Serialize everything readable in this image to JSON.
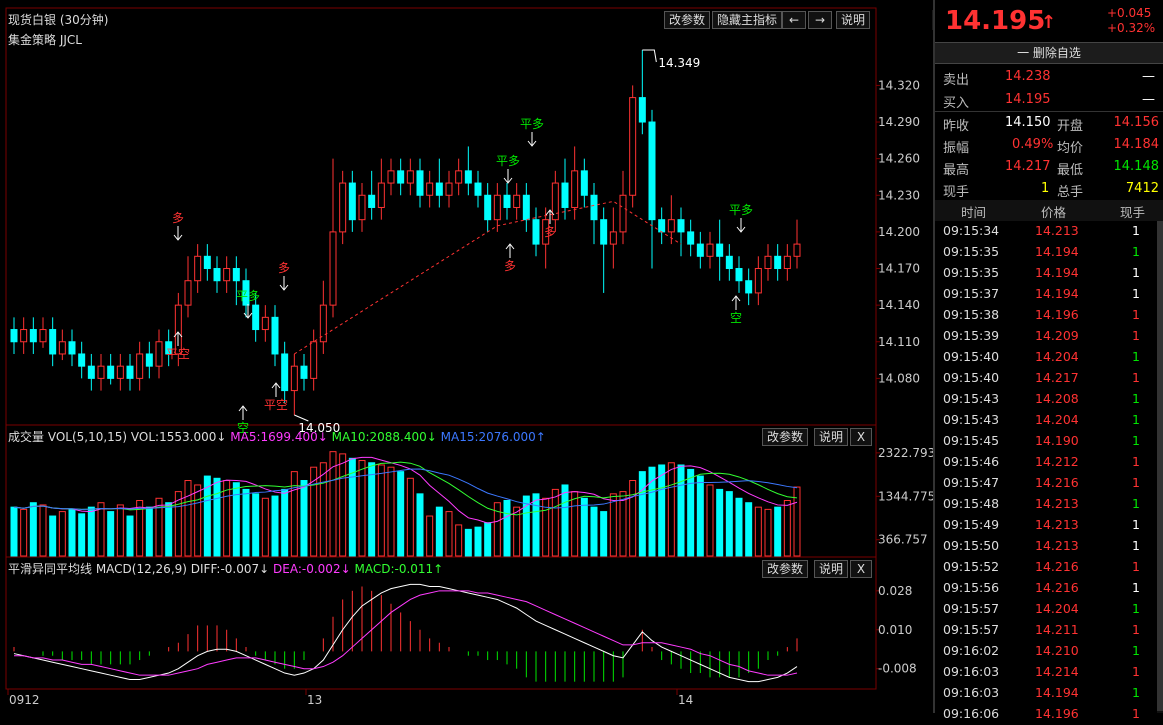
{
  "main_panel": {
    "title": "现货白银 (30分钟)",
    "subtitle": "集金策略 JJCL",
    "buttons": [
      "改参数",
      "隐藏主指标",
      "←",
      "→",
      "说明"
    ],
    "y_ticks": [
      "14.320",
      "14.290",
      "14.260",
      "14.230",
      "14.200",
      "14.170",
      "14.140",
      "14.110",
      "14.080"
    ],
    "high_label": "14.349",
    "low_label": "14.050",
    "signals": [
      "多",
      "平空",
      "平多",
      "空",
      "平空",
      "多",
      "平多",
      "平多",
      "多",
      "多",
      "平多",
      "空"
    ]
  },
  "volume_panel": {
    "title": "成交量 VOL(5,10,15) VOL:1553.000↓",
    "ma5": "MA5:1699.400↓",
    "ma10": "MA10:2088.400↓",
    "ma15": "MA15:2076.000↑",
    "buttons": [
      "改参数",
      "说明",
      "X"
    ],
    "y_ticks": [
      "2322.793",
      "1344.775",
      "366.757"
    ]
  },
  "macd_panel": {
    "title": "平滑异同平均线 MACD(12,26,9) DIFF:-0.007↓",
    "dea": "DEA:-0.002↓",
    "macd": "MACD:-0.011↑",
    "buttons": [
      "改参数",
      "说明",
      "X"
    ],
    "y_ticks": [
      "0.028",
      "0.010",
      "-0.008"
    ]
  },
  "x_axis": {
    "labels": [
      "0912",
      "13",
      "14"
    ]
  },
  "quote": {
    "name": "现货白银",
    "price": "14.195",
    "arrow": "↑",
    "change": "+0.045",
    "change_pct": "+0.32%",
    "remove_button": "一 删除自选",
    "sell_label": "卖出",
    "sell_price": "14.238",
    "sell_vol": "—",
    "buy_label": "买入",
    "buy_price": "14.195",
    "buy_vol": "—",
    "stats": [
      {
        "l1": "昨收",
        "v1": "14.150",
        "l2": "开盘",
        "v2": "14.156"
      },
      {
        "l1": "振幅",
        "v1": "0.49%",
        "l2": "均价",
        "v2": "14.184"
      },
      {
        "l1": "最高",
        "v1": "14.217",
        "l2": "最低",
        "v2": "14.148"
      },
      {
        "l1": "现手",
        "v1": "1",
        "l2": "总手",
        "v2": "7412"
      }
    ]
  },
  "ticks": {
    "headers": [
      "时间",
      "价格",
      "现手"
    ],
    "rows": [
      {
        "time": "09:15:34",
        "price": "14.213",
        "vol": "1",
        "vc": "white"
      },
      {
        "time": "09:15:35",
        "price": "14.194",
        "vol": "1",
        "vc": "green"
      },
      {
        "time": "09:15:35",
        "price": "14.194",
        "vol": "1",
        "vc": "white"
      },
      {
        "time": "09:15:37",
        "price": "14.194",
        "vol": "1",
        "vc": "white"
      },
      {
        "time": "09:15:38",
        "price": "14.196",
        "vol": "1",
        "vc": "red"
      },
      {
        "time": "09:15:39",
        "price": "14.209",
        "vol": "1",
        "vc": "red"
      },
      {
        "time": "09:15:40",
        "price": "14.204",
        "vol": "1",
        "vc": "green"
      },
      {
        "time": "09:15:40",
        "price": "14.217",
        "vol": "1",
        "vc": "red"
      },
      {
        "time": "09:15:43",
        "price": "14.208",
        "vol": "1",
        "vc": "green"
      },
      {
        "time": "09:15:43",
        "price": "14.204",
        "vol": "1",
        "vc": "green"
      },
      {
        "time": "09:15:45",
        "price": "14.190",
        "vol": "1",
        "vc": "green"
      },
      {
        "time": "09:15:46",
        "price": "14.212",
        "vol": "1",
        "vc": "red"
      },
      {
        "time": "09:15:47",
        "price": "14.216",
        "vol": "1",
        "vc": "red"
      },
      {
        "time": "09:15:48",
        "price": "14.213",
        "vol": "1",
        "vc": "green"
      },
      {
        "time": "09:15:49",
        "price": "14.213",
        "vol": "1",
        "vc": "white"
      },
      {
        "time": "09:15:50",
        "price": "14.213",
        "vol": "1",
        "vc": "white"
      },
      {
        "time": "09:15:52",
        "price": "14.216",
        "vol": "1",
        "vc": "red"
      },
      {
        "time": "09:15:56",
        "price": "14.216",
        "vol": "1",
        "vc": "white"
      },
      {
        "time": "09:15:57",
        "price": "14.204",
        "vol": "1",
        "vc": "green"
      },
      {
        "time": "09:15:57",
        "price": "14.211",
        "vol": "1",
        "vc": "red"
      },
      {
        "time": "09:16:02",
        "price": "14.210",
        "vol": "1",
        "vc": "green"
      },
      {
        "time": "09:16:03",
        "price": "14.214",
        "vol": "1",
        "vc": "red"
      },
      {
        "time": "09:16:03",
        "price": "14.194",
        "vol": "1",
        "vc": "green"
      },
      {
        "time": "09:16:06",
        "price": "14.196",
        "vol": "1",
        "vc": "red"
      }
    ]
  },
  "chart_data": {
    "type": "candlestick",
    "price_range": [
      14.05,
      14.349
    ],
    "candles": [
      [
        14.12,
        14.11,
        14.13,
        14.1
      ],
      [
        14.11,
        14.12,
        14.13,
        14.1
      ],
      [
        14.12,
        14.11,
        14.13,
        14.1
      ],
      [
        14.11,
        14.12,
        14.13,
        14.105
      ],
      [
        14.12,
        14.1,
        14.13,
        14.09
      ],
      [
        14.1,
        14.11,
        14.12,
        14.095
      ],
      [
        14.11,
        14.1,
        14.12,
        14.09
      ],
      [
        14.1,
        14.09,
        14.11,
        14.08
      ],
      [
        14.09,
        14.08,
        14.1,
        14.07
      ],
      [
        14.08,
        14.09,
        14.1,
        14.07
      ],
      [
        14.09,
        14.08,
        14.1,
        14.075
      ],
      [
        14.08,
        14.09,
        14.1,
        14.07
      ],
      [
        14.09,
        14.08,
        14.1,
        14.07
      ],
      [
        14.08,
        14.1,
        14.11,
        14.07
      ],
      [
        14.1,
        14.09,
        14.11,
        14.08
      ],
      [
        14.09,
        14.11,
        14.12,
        14.08
      ],
      [
        14.11,
        14.1,
        14.12,
        14.09
      ],
      [
        14.1,
        14.14,
        14.15,
        14.09
      ],
      [
        14.14,
        14.16,
        14.18,
        14.13
      ],
      [
        14.16,
        14.18,
        14.19,
        14.15
      ],
      [
        14.18,
        14.17,
        14.19,
        14.16
      ],
      [
        14.17,
        14.16,
        14.18,
        14.15
      ],
      [
        14.16,
        14.17,
        14.18,
        14.15
      ],
      [
        14.17,
        14.16,
        14.18,
        14.14
      ],
      [
        14.16,
        14.14,
        14.17,
        14.13
      ],
      [
        14.14,
        14.12,
        14.15,
        14.11
      ],
      [
        14.12,
        14.13,
        14.14,
        14.11
      ],
      [
        14.13,
        14.1,
        14.14,
        14.09
      ],
      [
        14.1,
        14.07,
        14.11,
        14.06
      ],
      [
        14.07,
        14.09,
        14.1,
        14.05
      ],
      [
        14.09,
        14.08,
        14.1,
        14.07
      ],
      [
        14.08,
        14.11,
        14.12,
        14.07
      ],
      [
        14.11,
        14.14,
        14.16,
        14.1
      ],
      [
        14.14,
        14.2,
        14.26,
        14.13
      ],
      [
        14.2,
        14.24,
        14.25,
        14.19
      ],
      [
        14.24,
        14.21,
        14.25,
        14.2
      ],
      [
        14.21,
        14.23,
        14.24,
        14.2
      ],
      [
        14.23,
        14.22,
        14.25,
        14.21
      ],
      [
        14.22,
        14.24,
        14.26,
        14.21
      ],
      [
        14.24,
        14.25,
        14.26,
        14.23
      ],
      [
        14.25,
        14.24,
        14.26,
        14.23
      ],
      [
        14.24,
        14.25,
        14.26,
        14.23
      ],
      [
        14.25,
        14.23,
        14.26,
        14.22
      ],
      [
        14.23,
        14.24,
        14.25,
        14.22
      ],
      [
        14.24,
        14.23,
        14.26,
        14.22
      ],
      [
        14.23,
        14.24,
        14.25,
        14.22
      ],
      [
        14.24,
        14.25,
        14.26,
        14.23
      ],
      [
        14.25,
        14.24,
        14.27,
        14.23
      ],
      [
        14.24,
        14.23,
        14.25,
        14.22
      ],
      [
        14.23,
        14.21,
        14.24,
        14.2
      ],
      [
        14.21,
        14.23,
        14.24,
        14.2
      ],
      [
        14.23,
        14.22,
        14.24,
        14.21
      ],
      [
        14.22,
        14.23,
        14.24,
        14.21
      ],
      [
        14.23,
        14.21,
        14.24,
        14.2
      ],
      [
        14.21,
        14.19,
        14.22,
        14.18
      ],
      [
        14.19,
        14.21,
        14.22,
        14.17
      ],
      [
        14.21,
        14.24,
        14.25,
        14.2
      ],
      [
        14.24,
        14.22,
        14.26,
        14.21
      ],
      [
        14.22,
        14.25,
        14.27,
        14.21
      ],
      [
        14.25,
        14.23,
        14.26,
        14.22
      ],
      [
        14.23,
        14.21,
        14.24,
        14.19
      ],
      [
        14.21,
        14.19,
        14.22,
        14.15
      ],
      [
        14.19,
        14.2,
        14.22,
        14.17
      ],
      [
        14.2,
        14.23,
        14.25,
        14.19
      ],
      [
        14.23,
        14.31,
        14.32,
        14.22
      ],
      [
        14.31,
        14.29,
        14.349,
        14.28
      ],
      [
        14.29,
        14.21,
        14.3,
        14.17
      ],
      [
        14.21,
        14.2,
        14.22,
        14.19
      ],
      [
        14.2,
        14.21,
        14.23,
        14.19
      ],
      [
        14.21,
        14.2,
        14.22,
        14.18
      ],
      [
        14.2,
        14.19,
        14.21,
        14.18
      ],
      [
        14.19,
        14.18,
        14.2,
        14.17
      ],
      [
        14.18,
        14.19,
        14.2,
        14.17
      ],
      [
        14.19,
        14.18,
        14.21,
        14.16
      ],
      [
        14.18,
        14.17,
        14.19,
        14.16
      ],
      [
        14.17,
        14.16,
        14.18,
        14.15
      ],
      [
        14.16,
        14.15,
        14.17,
        14.14
      ],
      [
        14.15,
        14.17,
        14.18,
        14.14
      ],
      [
        14.17,
        14.18,
        14.19,
        14.16
      ],
      [
        14.18,
        14.17,
        14.19,
        14.16
      ],
      [
        14.17,
        14.18,
        14.19,
        14.16
      ],
      [
        14.18,
        14.19,
        14.21,
        14.17
      ]
    ],
    "volumes": [
      1100,
      1050,
      1200,
      1150,
      900,
      1000,
      1050,
      950,
      1100,
      1200,
      1000,
      1150,
      900,
      1250,
      1100,
      1300,
      1200,
      1450,
      1700,
      1600,
      1800,
      1750,
      1700,
      1650,
      1500,
      1400,
      1300,
      1350,
      1500,
      1900,
      1700,
      2000,
      2100,
      2350,
      2300,
      2200,
      2150,
      2100,
      2050,
      2000,
      1900,
      1750,
      1400,
      900,
      1100,
      1000,
      700,
      600,
      650,
      750,
      1200,
      1250,
      1100,
      1350,
      1400,
      1300,
      1500,
      1600,
      1450,
      1300,
      1100,
      1000,
      1400,
      1450,
      1700,
      1900,
      2000,
      2050,
      2100,
      2050,
      1950,
      1800,
      1600,
      1500,
      1450,
      1300,
      1200,
      1100,
      1050,
      1100,
      1250,
      1553
    ],
    "macd": {
      "diff": [
        -0.001,
        -0.002,
        -0.003,
        -0.004,
        -0.005,
        -0.006,
        -0.007,
        -0.008,
        -0.009,
        -0.01,
        -0.011,
        -0.012,
        -0.013,
        -0.013,
        -0.012,
        -0.011,
        -0.01,
        -0.008,
        -0.005,
        -0.002,
        0.0,
        0.001,
        0.001,
        0.0,
        -0.002,
        -0.004,
        -0.006,
        -0.008,
        -0.01,
        -0.011,
        -0.01,
        -0.008,
        -0.004,
        0.003,
        0.01,
        0.016,
        0.021,
        0.024,
        0.027,
        0.029,
        0.03,
        0.031,
        0.031,
        0.03,
        0.03,
        0.029,
        0.028,
        0.027,
        0.026,
        0.025,
        0.024,
        0.022,
        0.02,
        0.017,
        0.014,
        0.012,
        0.01,
        0.008,
        0.006,
        0.004,
        0.002,
        0.0,
        -0.002,
        -0.003,
        0.003,
        0.009,
        0.005,
        0.002,
        0.0,
        -0.002,
        -0.004,
        -0.006,
        -0.008,
        -0.01,
        -0.012,
        -0.013,
        -0.014,
        -0.014,
        -0.013,
        -0.012,
        -0.01,
        -0.007
      ],
      "dea": [
        -0.002,
        -0.002,
        -0.003,
        -0.003,
        -0.004,
        -0.004,
        -0.005,
        -0.006,
        -0.006,
        -0.007,
        -0.008,
        -0.009,
        -0.01,
        -0.011,
        -0.011,
        -0.011,
        -0.011,
        -0.01,
        -0.009,
        -0.008,
        -0.006,
        -0.005,
        -0.004,
        -0.003,
        -0.003,
        -0.003,
        -0.004,
        -0.005,
        -0.006,
        -0.007,
        -0.008,
        -0.008,
        -0.007,
        -0.005,
        -0.002,
        0.002,
        0.006,
        0.01,
        0.014,
        0.018,
        0.021,
        0.024,
        0.026,
        0.027,
        0.028,
        0.028,
        0.028,
        0.028,
        0.027,
        0.027,
        0.026,
        0.025,
        0.024,
        0.023,
        0.021,
        0.019,
        0.017,
        0.015,
        0.013,
        0.011,
        0.009,
        0.007,
        0.005,
        0.003,
        0.003,
        0.004,
        0.004,
        0.004,
        0.003,
        0.002,
        0.001,
        -0.001,
        -0.002,
        -0.004,
        -0.006,
        -0.007,
        -0.009,
        -0.01,
        -0.011,
        -0.011,
        -0.011,
        -0.01
      ]
    }
  }
}
